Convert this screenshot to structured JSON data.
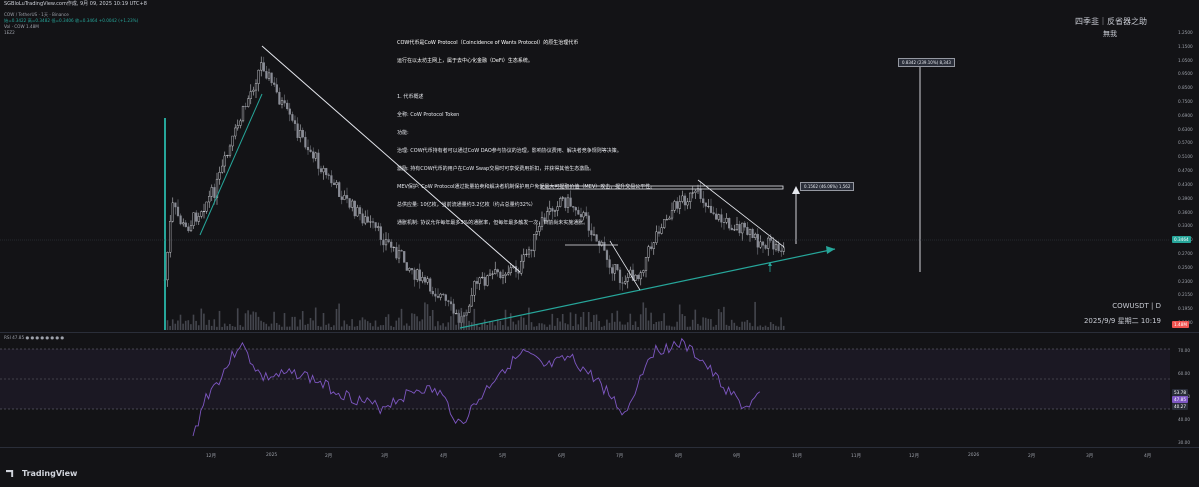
{
  "header": {
    "title": "SGBloLuTradingView.com作成, 9月 09, 2025 10:19 UTC+8"
  },
  "legend": {
    "symbol_line": "COW / TetherUS · 1天 · Binance",
    "ohlc": "始=0.3422  高=0.3482  低=0.3406  收=0.3464  +0.0042 (+1.23%)",
    "volume": "Vol · COW  1.48M",
    "extra": "1EZ2"
  },
  "annotation": {
    "heading": "COW代币是CoW Protocol（Coincidence of Wants Protocol）的原生治理代币",
    "subheading": "运行在以太坊主网上，属于去中心化金融（DeFi）生态系统。",
    "lines": [
      "1. 代币概述",
      "全称: CoW Protocol Token",
      "功能:",
      "治理: COW代币持有者可以通过CoW DAO参与协议的治理，影响协议费用、解决者竞争规则等决策。",
      "激励: 持有COW代币的用户在CoW Swap交易时可享受费用折扣，并获得其他生态激励。",
      "MEV保护: CoW Protocol通过批量拍卖和解决者机制保护用户免受最大可提取价值（MEV）攻击，提升交易公平性。",
      "总供应量: 10亿枚，当前流通量约3.2亿枚（约占总量约32%）",
      "通胀机制: 协议允许每年最多3%的通胀率，但每年最多触发一次，目前尚未实施通胀。"
    ]
  },
  "watermark": {
    "line1": "四季韭｜反省器之助",
    "line2": "無我"
  },
  "chart_info": {
    "symbol": "COWUSDT | D",
    "datetime": "2025/9/9 星期二 10:19"
  },
  "measures": {
    "small": "0.1562 (46.06%) 1,562",
    "large": "0.8342 (239.10%) 8,343"
  },
  "price_axis": [
    "1.2500",
    "1.1500",
    "1.0500",
    "0.9500",
    "0.8500",
    "0.7500",
    "0.6900",
    "0.6300",
    "0.5700",
    "0.5100",
    "0.4700",
    "0.4300",
    "0.3900",
    "0.3600",
    "0.3300",
    "0.3000",
    "0.2700",
    "0.2500",
    "0.2300",
    "0.2150",
    "0.1950",
    "0.1800"
  ],
  "price_tags": {
    "last": "0.3464",
    "volume": "1.48M"
  },
  "rsi": {
    "label": "RSI  47.85  ●  ●  ●  ●  ●  ●  ●  ●",
    "axis": [
      "70.00",
      "60.00",
      "50.00",
      "40.00",
      "30.00"
    ],
    "tags": [
      "53.78",
      "47.85",
      "40.27"
    ]
  },
  "time_axis": [
    "12月",
    "2025",
    "2月",
    "3月",
    "4月",
    "5月",
    "6月",
    "7月",
    "8月",
    "9月",
    "10月",
    "11月",
    "12月",
    "2026",
    "2月",
    "3月",
    "4月"
  ],
  "brand": "TradingView",
  "colors": {
    "up": "#26a69a",
    "down": "#ef5350",
    "candle": "#c8cad0",
    "trendline": "#ffffff",
    "support": "#26a69a",
    "rsi": "#7e57c2"
  },
  "chart_data": {
    "type": "candlestick",
    "ylabel": "",
    "ylim": [
      0.18,
      1.3
    ]
  }
}
